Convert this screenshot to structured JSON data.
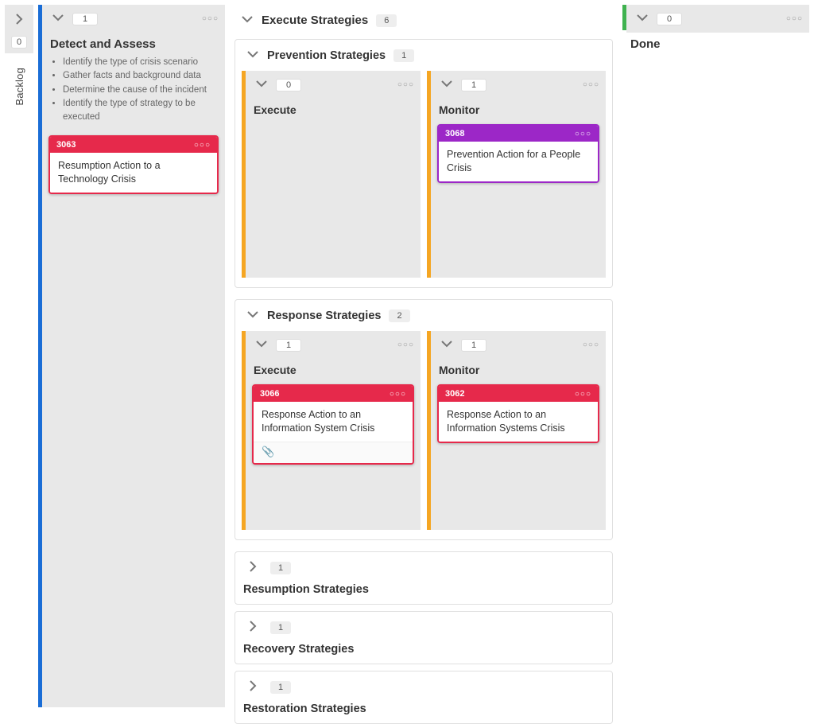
{
  "colors": {
    "blue": "#1a6dd6",
    "green": "#3fb24f",
    "orange": "#f5a623",
    "red": "#e6294b",
    "purple": "#9c27c7"
  },
  "backlog": {
    "label": "Backlog",
    "count": "0"
  },
  "detect": {
    "count": "1",
    "title": "Detect and Assess",
    "bullets": [
      "Identify the type of crisis scenario",
      "Gather facts and background data",
      "Determine the cause of the incident",
      "Identify the type of strategy to be executed"
    ],
    "card": {
      "id": "3063",
      "title": "Resumption Action to a Technology Crisis"
    }
  },
  "execute": {
    "header_title": "Execute Strategies",
    "header_count": "6",
    "sections": {
      "prevention": {
        "title": "Prevention Strategies",
        "count": "1",
        "lanes": {
          "execute": {
            "title": "Execute",
            "count": "0"
          },
          "monitor": {
            "title": "Monitor",
            "count": "1",
            "card": {
              "id": "3068",
              "title": "Prevention Action for a People Crisis"
            }
          }
        }
      },
      "response": {
        "title": "Response Strategies",
        "count": "2",
        "lanes": {
          "execute": {
            "title": "Execute",
            "count": "1",
            "card": {
              "id": "3066",
              "title": "Response Action to an Information System Crisis",
              "has_attachment": true
            }
          },
          "monitor": {
            "title": "Monitor",
            "count": "1",
            "card": {
              "id": "3062",
              "title": "Response Action to an Information Systems Crisis"
            }
          }
        }
      },
      "resumption": {
        "title": "Resumption Strategies",
        "count": "1"
      },
      "recovery": {
        "title": "Recovery Strategies",
        "count": "1"
      },
      "restoration": {
        "title": "Restoration Strategies",
        "count": "1"
      }
    }
  },
  "done": {
    "count": "0",
    "title": "Done"
  }
}
